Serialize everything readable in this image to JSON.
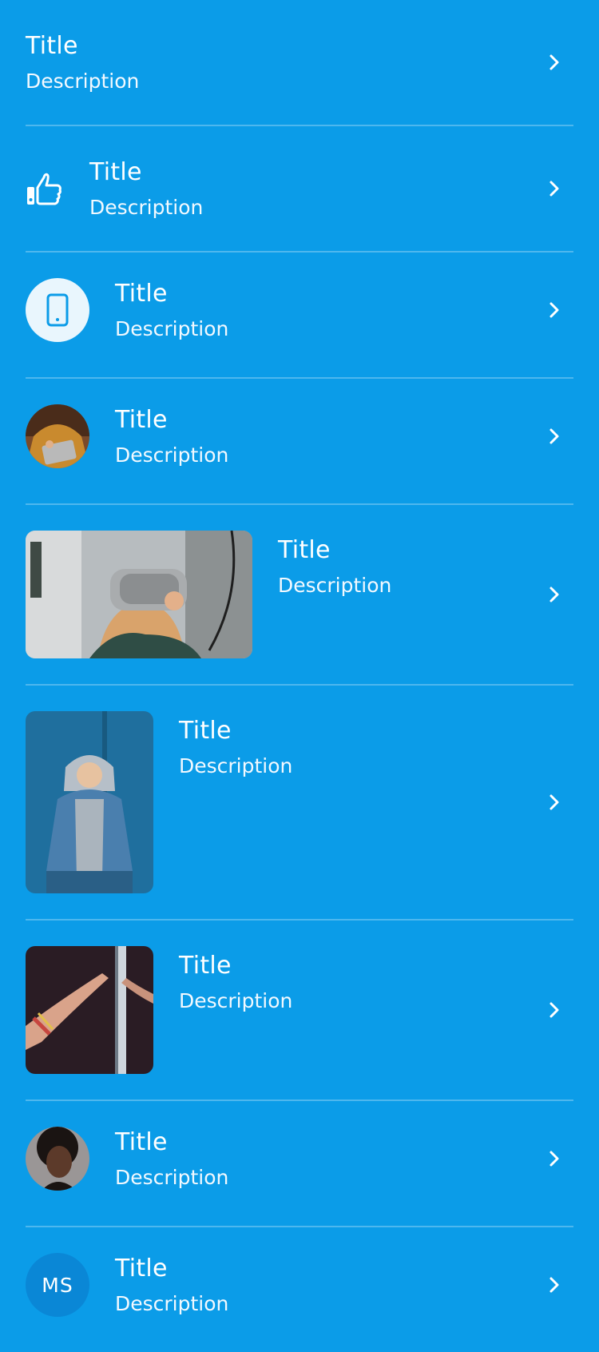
{
  "colors": {
    "background": "#0B9CE8",
    "text": "#ffffff",
    "divider": "rgba(255,255,255,0.28)",
    "initials_bg": "#0A87D6"
  },
  "items": [
    {
      "title": "Title",
      "description": "Description",
      "leading": "none"
    },
    {
      "title": "Title",
      "description": "Description",
      "leading": "thumbs-up-icon"
    },
    {
      "title": "Title",
      "description": "Description",
      "leading": "phone-icon"
    },
    {
      "title": "Title",
      "description": "Description",
      "leading": "avatar-photo"
    },
    {
      "title": "Title",
      "description": "Description",
      "leading": "vr-headset-photo"
    },
    {
      "title": "Title",
      "description": "Description",
      "leading": "hoodie-person-photo"
    },
    {
      "title": "Title",
      "description": "Description",
      "leading": "hands-photo"
    },
    {
      "title": "Title",
      "description": "Description",
      "leading": "portrait-photo"
    },
    {
      "title": "Title",
      "description": "Description",
      "leading": "initials-avatar",
      "initials": "MS"
    }
  ],
  "trailing_icon": "chevron-right-icon"
}
